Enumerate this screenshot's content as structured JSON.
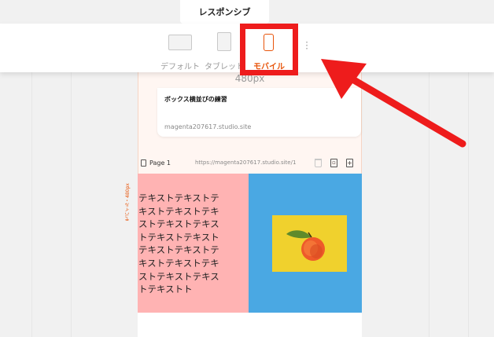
{
  "tabs": {
    "responsive": "レスポンシブ"
  },
  "devices": {
    "default_label": "デフォルト",
    "tablet_label": "タブレット",
    "mobile_label": "モバイル"
  },
  "frame": {
    "width_label": "480px",
    "side_label": "モバイル・480px"
  },
  "preview_card": {
    "title": "ボックス横並びの練習",
    "url": "magenta207617.studio.site"
  },
  "page_bar": {
    "page_name": "Page 1",
    "url": "https://magenta207617.studio.site/1"
  },
  "content": {
    "text": "テキストテキストテキストテキストテキストテキストテキストテキストテキストテキストテキストテキストテキストテキストテキストテキストテキストト"
  },
  "colors": {
    "accent": "#e8540a",
    "highlight_red": "#ee1c1c",
    "pink": "#ffb3b3",
    "blue": "#4aa8e3",
    "yellow": "#f0d12d"
  }
}
